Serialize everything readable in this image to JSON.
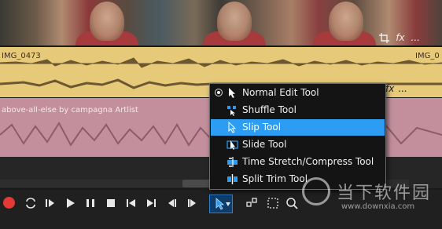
{
  "video_track": {
    "frame_icons": [
      "crop-icon",
      "fx-icon",
      "more-icon"
    ],
    "fx_label": "fx",
    "more_label": "..."
  },
  "audio_tracks": [
    {
      "left_label": "IMG_0473",
      "right_label": "IMG_0",
      "color": "#e7c97a",
      "side_fx": "fx",
      "side_more": "..."
    },
    {
      "left_label": "above-all-else by campagna Artlist",
      "color": "#c48f9d"
    }
  ],
  "tool_menu": {
    "items": [
      {
        "label": "Normal Edit Tool",
        "icon": "arrow-cursor-icon",
        "checked": true,
        "selected": false
      },
      {
        "label": "Shuffle Tool",
        "icon": "shuffle-icon",
        "checked": false,
        "selected": false
      },
      {
        "label": "Slip Tool",
        "icon": "slip-cursor-icon",
        "checked": false,
        "selected": true
      },
      {
        "label": "Slide Tool",
        "icon": "slide-icon",
        "checked": false,
        "selected": false
      },
      {
        "label": "Time Stretch/Compress Tool",
        "icon": "time-stretch-icon",
        "checked": false,
        "selected": false
      },
      {
        "label": "Split Trim Tool",
        "icon": "split-trim-icon",
        "checked": false,
        "selected": false
      }
    ]
  },
  "transport": {
    "buttons": [
      "record-icon",
      "loop-icon",
      "play-from-start-icon",
      "play-icon",
      "pause-icon",
      "stop-icon",
      "go-to-start-icon",
      "go-to-end-icon",
      "prev-frame-icon",
      "next-frame-icon"
    ],
    "active_tool_icon": "arrow-cursor-icon",
    "accent": "#2c9df2",
    "record_color": "#e53935"
  },
  "watermark": {
    "title": "当下软件园",
    "url": "www.downxia.com"
  }
}
